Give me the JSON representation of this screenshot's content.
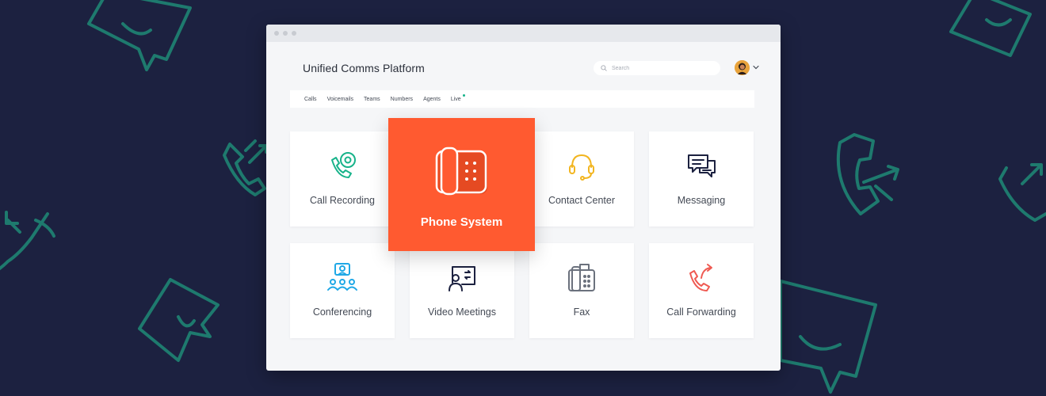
{
  "app": {
    "title": "Unified Comms Platform"
  },
  "search": {
    "placeholder": "Search",
    "value": ""
  },
  "tabs": [
    {
      "label": "Calls"
    },
    {
      "label": "Voicemails"
    },
    {
      "label": "Teams"
    },
    {
      "label": "Numbers"
    },
    {
      "label": "Agents"
    },
    {
      "label": "Live"
    }
  ],
  "featured": {
    "label": "Phone System",
    "icon": "desk-phone-icon"
  },
  "cards": [
    {
      "label": "Call Recording",
      "icon": "call-recording-icon"
    },
    {
      "label": "Contact Center",
      "icon": "headset-icon"
    },
    {
      "label": "Messaging",
      "icon": "chat-bubbles-icon"
    },
    {
      "label": "Conferencing",
      "icon": "conference-icon"
    },
    {
      "label": "Video Meetings",
      "icon": "video-meeting-icon"
    },
    {
      "label": "Fax",
      "icon": "fax-icon"
    },
    {
      "label": "Call Forwarding",
      "icon": "call-forward-icon"
    }
  ],
  "colors": {
    "background": "#1c2140",
    "decoration": "#1e7a6e",
    "accent": "#ff5a30",
    "green": "#17b38a",
    "yellow": "#f2b51f",
    "blue": "#1fa8e6",
    "red": "#ef5a52",
    "live_indicator": "#17b38a"
  }
}
